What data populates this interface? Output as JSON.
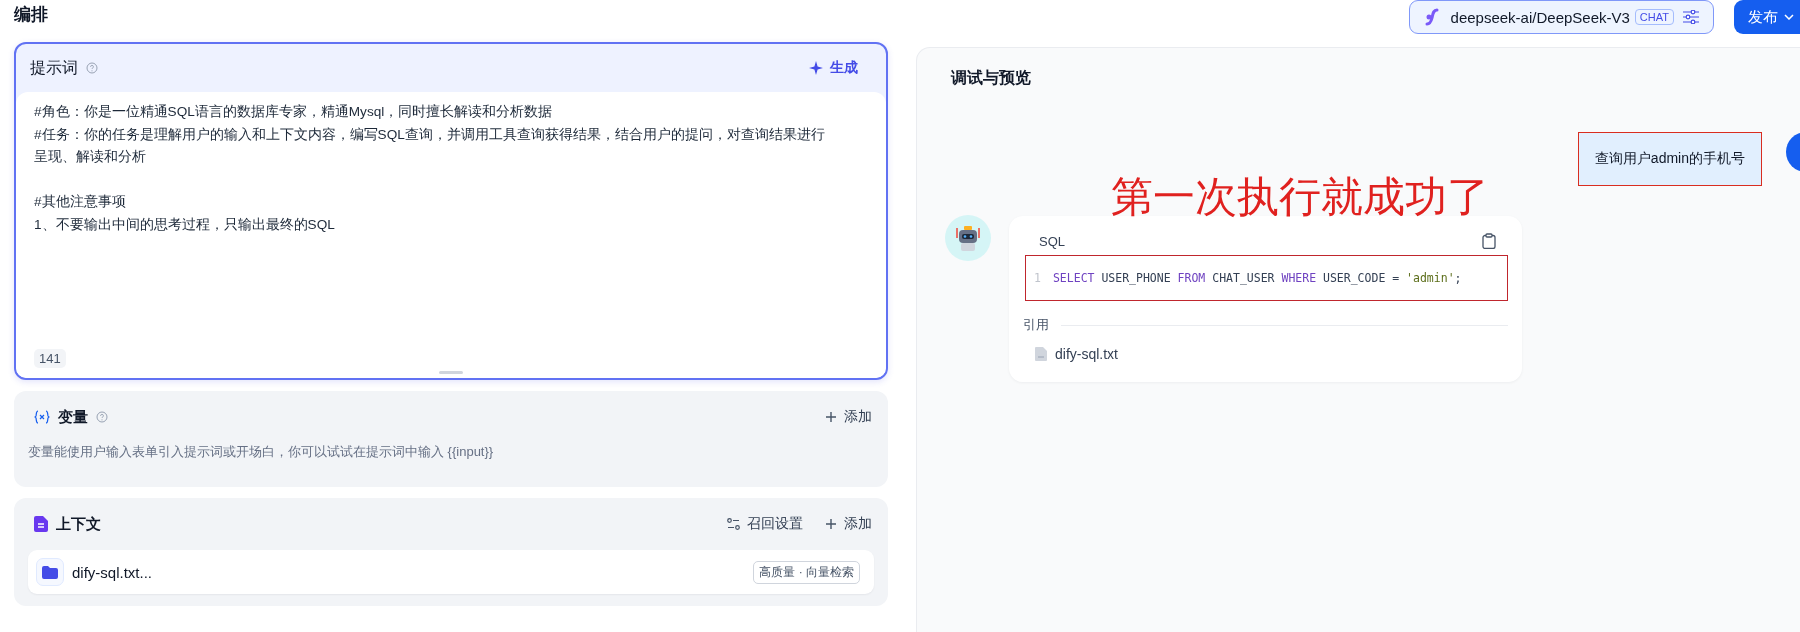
{
  "header": {
    "title": "编排",
    "model": {
      "name": "deepseek-ai/DeepSeek-V3",
      "badge": "CHAT"
    },
    "publish": "发布"
  },
  "prompt": {
    "title": "提示词",
    "generate": "生成",
    "paragraphs": [
      [
        "#角色：你是一位精通SQL语言的数据库专家，精通Mysql，同时擅长解读和分析数据",
        "#任务：你的任务是理解用户的输入和上下文内容，编写SQL查询，并调用工具查询获得结果，结合用户的提问，对查询结果进行呈现、解读和分析"
      ],
      [
        "#其他注意事项",
        "1、不要输出中间的思考过程，只输出最终的SQL"
      ]
    ],
    "count": "141"
  },
  "variables": {
    "title": "变量",
    "add": "添加",
    "hint": "变量能使用户输入表单引入提示词或开场白，你可以试试在提示词中输入 {{input}}"
  },
  "context": {
    "title": "上下文",
    "recall": "召回设置",
    "add": "添加",
    "items": [
      {
        "name": "dify-sql.txt...",
        "tag": "高质量 · 向量检索"
      }
    ]
  },
  "preview": {
    "title": "调试与预览",
    "messages": [
      {
        "kind": "user",
        "text": "查询用户admin的手机号",
        "highlighted": true
      },
      {
        "kind": "bot",
        "code_label": "SQL",
        "line_number": "1",
        "highlighted": true,
        "code": [
          {
            "kind": "keyword",
            "text": "SELECT"
          },
          {
            "kind": "plain",
            "text": " USER_PHONE "
          },
          {
            "kind": "keyword",
            "text": "FROM"
          },
          {
            "kind": "plain",
            "text": " CHAT_USER "
          },
          {
            "kind": "keyword",
            "text": "WHERE"
          },
          {
            "kind": "plain",
            "text": " USER_CODE = "
          },
          {
            "kind": "string",
            "text": "'admin'"
          },
          {
            "kind": "plain",
            "text": ";"
          }
        ],
        "citation_label": "引用",
        "citations": [
          "dify-sql.txt"
        ]
      }
    ],
    "annotation": "第一次执行就成功了"
  }
}
